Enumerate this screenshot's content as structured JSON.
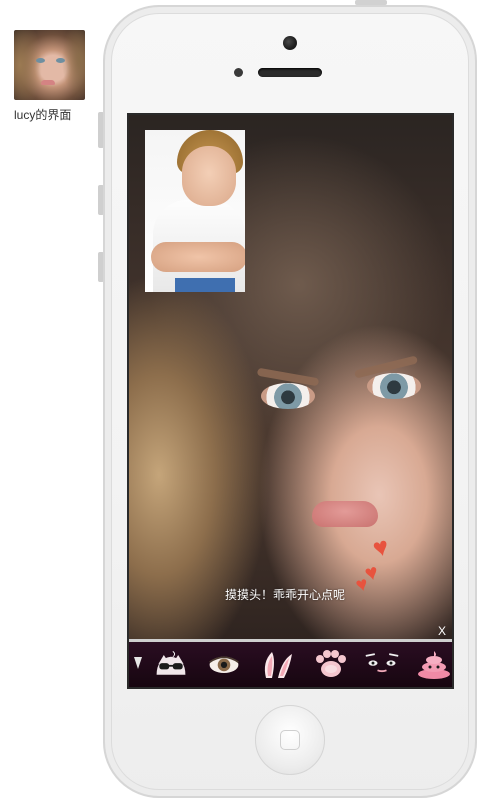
{
  "sidebar": {
    "thumbnail_caption": "lucy的界面"
  },
  "call": {
    "message": "摸摸头！乖乖开心点呢",
    "close_label": "X",
    "heart_color": "#e8533e"
  },
  "stickers": [
    {
      "icon": "partial-sticker-icon"
    },
    {
      "icon": "sunglasses-cat-sticker-icon"
    },
    {
      "icon": "eye-sticker-icon"
    },
    {
      "icon": "bunny-ears-sticker-icon"
    },
    {
      "icon": "paw-sticker-icon"
    },
    {
      "icon": "cat-eyes-sticker-icon"
    },
    {
      "icon": "pink-poop-sticker-icon"
    }
  ]
}
